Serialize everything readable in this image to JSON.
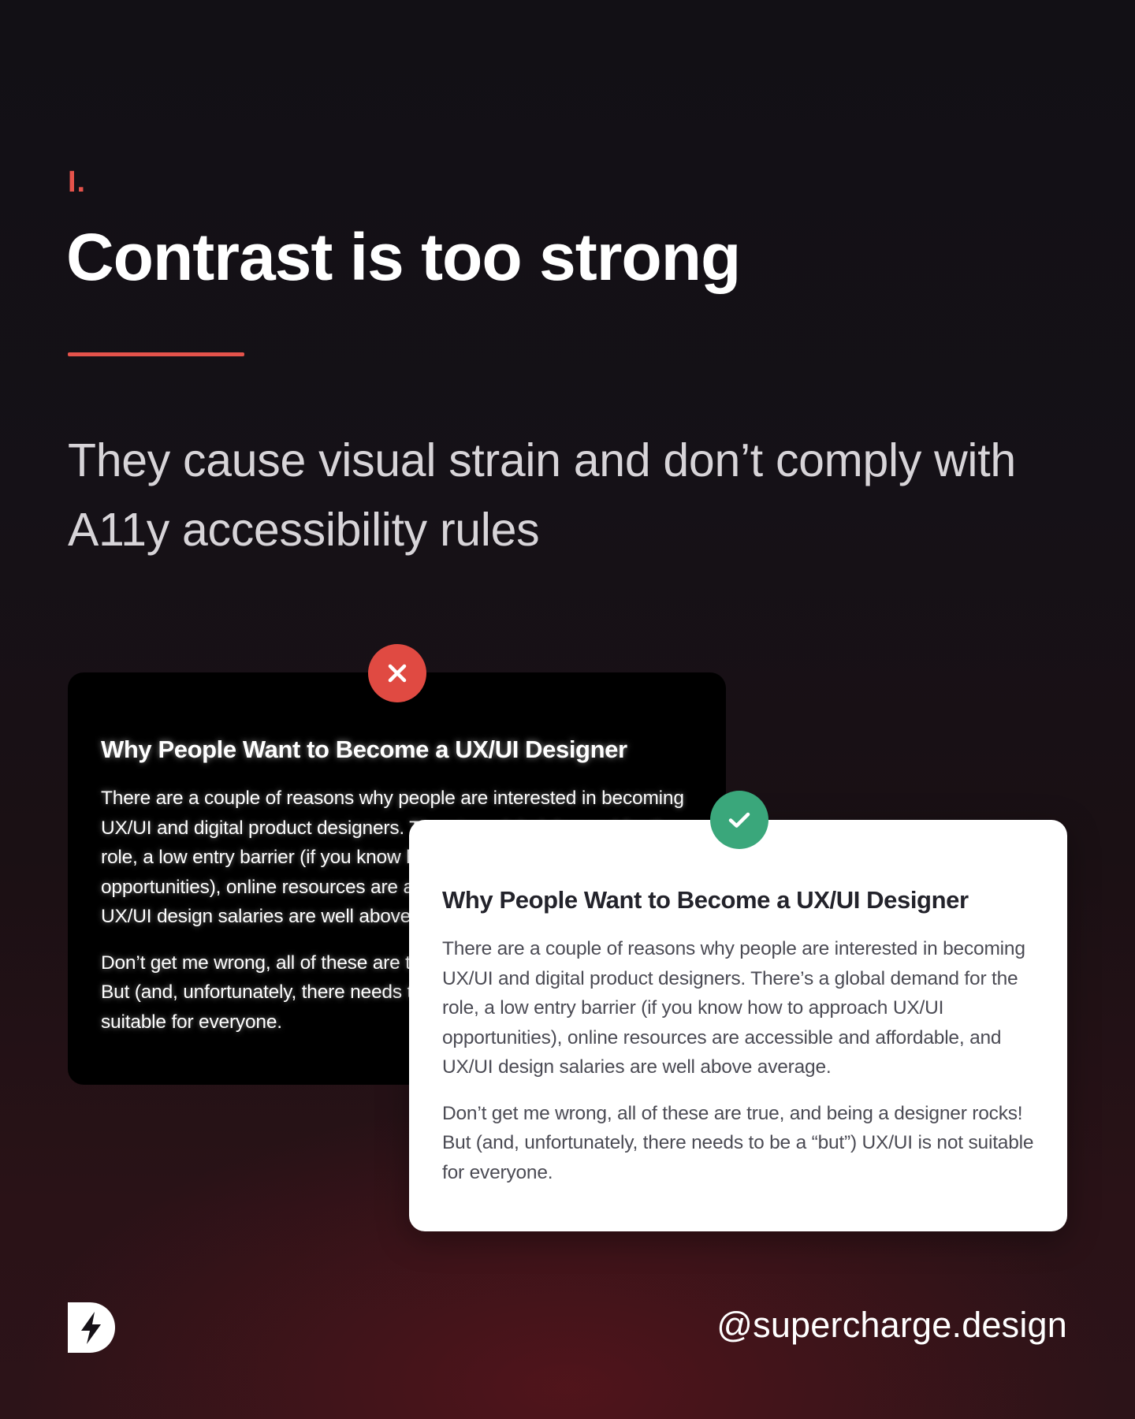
{
  "header": {
    "eyebrow": "I.",
    "title": "Contrast is too strong",
    "subtitle": "They cause visual strain and don’t comply with A11y accessibility rules"
  },
  "examples": {
    "bad": {
      "status_icon": "close-icon",
      "heading": "Why People Want to Become a UX/UI Designer",
      "paragraphs": [
        "There are a couple of reasons why people are interested in becoming UX/UI and digital product designers. There’s a global demand for the role, a low entry barrier (if you know how to approach UX/UI opportunities), online resources are accessible and affordable, and UX/UI design salaries are well above average.",
        "Don’t get me wrong, all of these are true, and being a designer rocks! But (and, unfortunately, there needs to be a “but”) UX/UI is not suitable for everyone."
      ]
    },
    "good": {
      "status_icon": "check-icon",
      "heading": "Why People Want to Become a UX/UI Designer",
      "paragraphs": [
        "There are a couple of reasons why people are interested in becoming UX/UI and digital product designers. There’s a global demand for the role, a low entry barrier (if you know how to approach UX/UI opportunities), online resources are accessible and affordable, and UX/UI design salaries are well above average.",
        "Don’t get me wrong, all of these are true, and being a designer rocks! But (and, unfortunately, there needs to be a “but”) UX/UI is not suitable for everyone."
      ]
    }
  },
  "footer": {
    "logo_icon": "lightning-d-logo-icon",
    "handle": "@supercharge.design"
  },
  "colors": {
    "accent_red": "#e5534b",
    "success_green": "#3aa77b",
    "background_dark": "#151117",
    "card_dark": "#000000",
    "card_light": "#ffffff"
  }
}
